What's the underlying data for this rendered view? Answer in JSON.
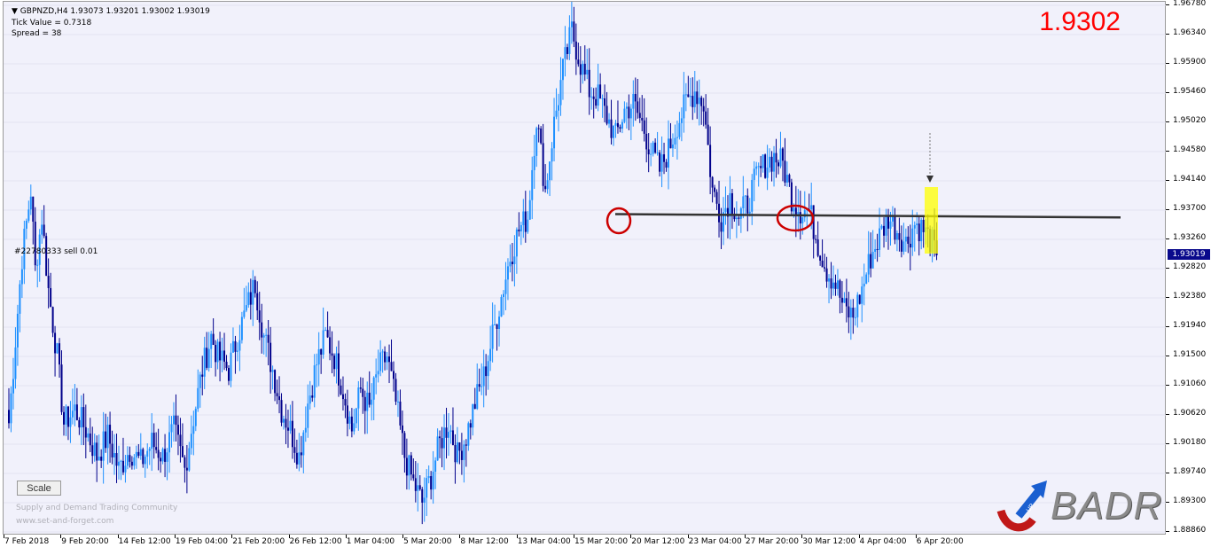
{
  "header": {
    "title_arrow": "▼",
    "symbol_line": "GBPNZD,H4  1.93073 1.93201 1.93002 1.93019",
    "tick_value": "Tick Value = 0.7318",
    "spread": "Spread = 38"
  },
  "big_price": "1.9302",
  "order_label": "#22780333 sell 0.01",
  "scale_button": "Scale",
  "watermark": {
    "line1": "Supply and Demand Trading Community",
    "line2": "www.set-and-forget.com"
  },
  "logo": {
    "text": "BADR",
    "small_text": "UP"
  },
  "price_axis": {
    "labels": [
      "1.96780",
      "1.96340",
      "1.95900",
      "1.95460",
      "1.95020",
      "1.94580",
      "1.94140",
      "1.93700",
      "1.93260",
      "1.92820",
      "1.92380",
      "1.91940",
      "1.91500",
      "1.91060",
      "1.90620",
      "1.90180",
      "1.89740",
      "1.89300",
      "1.88860"
    ],
    "current_price": "1.93019"
  },
  "time_axis": {
    "labels": [
      "7 Feb 2018",
      "9 Feb 20:00",
      "14 Feb 12:00",
      "19 Feb 04:00",
      "21 Feb 20:00",
      "26 Feb 12:00",
      "1 Mar 04:00",
      "5 Mar 20:00",
      "8 Mar 12:00",
      "13 Mar 04:00",
      "15 Mar 20:00",
      "20 Mar 12:00",
      "23 Mar 04:00",
      "27 Mar 20:00",
      "30 Mar 12:00",
      "4 Apr 04:00",
      "6 Apr 20:00"
    ]
  },
  "colors": {
    "bull": "#1e90ff",
    "bear": "#00008b",
    "background": "#f1f1fb",
    "price_highlight": "#ff0000",
    "level_line": "#333333",
    "highlight_box": "#ffff00",
    "circle": "#cc0000"
  },
  "chart_data": {
    "type": "candlestick",
    "symbol": "GBPNZD",
    "timeframe": "H4",
    "ylim": [
      1.8886,
      1.9678
    ],
    "ohlc_last": {
      "open": 1.93073,
      "high": 1.93201,
      "low": 1.93002,
      "close": 1.93019
    },
    "close_path": [
      [
        0,
        1.905
      ],
      [
        6,
        1.93
      ],
      [
        10,
        1.94
      ],
      [
        12,
        1.928
      ],
      [
        15,
        1.936
      ],
      [
        18,
        1.925
      ],
      [
        22,
        1.915
      ],
      [
        25,
        1.905
      ],
      [
        30,
        1.907
      ],
      [
        35,
        1.904
      ],
      [
        40,
        1.9
      ],
      [
        45,
        1.903
      ],
      [
        50,
        1.898
      ],
      [
        55,
        1.901
      ],
      [
        60,
        1.899
      ],
      [
        65,
        1.902
      ],
      [
        70,
        1.9
      ],
      [
        75,
        1.904
      ],
      [
        80,
        1.898
      ],
      [
        83,
        1.904
      ],
      [
        88,
        1.913
      ],
      [
        92,
        1.918
      ],
      [
        95,
        1.915
      ],
      [
        100,
        1.913
      ],
      [
        104,
        1.918
      ],
      [
        108,
        1.922
      ],
      [
        112,
        1.926
      ],
      [
        116,
        1.918
      ],
      [
        120,
        1.913
      ],
      [
        124,
        1.907
      ],
      [
        128,
        1.904
      ],
      [
        132,
        1.9
      ],
      [
        136,
        1.908
      ],
      [
        140,
        1.914
      ],
      [
        144,
        1.918
      ],
      [
        148,
        1.915
      ],
      [
        152,
        1.91
      ],
      [
        156,
        1.904
      ],
      [
        160,
        1.91
      ],
      [
        164,
        1.907
      ],
      [
        168,
        1.913
      ],
      [
        172,
        1.915
      ],
      [
        176,
        1.908
      ],
      [
        180,
        1.9
      ],
      [
        184,
        1.896
      ],
      [
        188,
        1.893
      ],
      [
        192,
        1.897
      ],
      [
        196,
        1.902
      ],
      [
        200,
        1.905
      ],
      [
        204,
        1.9
      ],
      [
        208,
        1.903
      ],
      [
        212,
        1.908
      ],
      [
        216,
        1.912
      ],
      [
        220,
        1.918
      ],
      [
        224,
        1.924
      ],
      [
        228,
        1.93
      ],
      [
        232,
        1.934
      ],
      [
        236,
        1.936
      ],
      [
        240,
        1.951
      ],
      [
        244,
        1.94
      ],
      [
        248,
        1.95
      ],
      [
        252,
        1.958
      ],
      [
        256,
        1.964
      ],
      [
        260,
        1.959
      ],
      [
        264,
        1.955
      ],
      [
        268,
        1.954
      ],
      [
        272,
        1.951
      ],
      [
        276,
        1.948
      ],
      [
        280,
        1.952
      ],
      [
        284,
        1.953
      ],
      [
        288,
        1.95
      ],
      [
        292,
        1.946
      ],
      [
        296,
        1.943
      ],
      [
        300,
        1.946
      ],
      [
        304,
        1.95
      ],
      [
        308,
        1.953
      ],
      [
        312,
        1.955
      ],
      [
        316,
        1.953
      ],
      [
        320,
        1.94
      ],
      [
        324,
        1.936
      ],
      [
        328,
        1.939
      ],
      [
        332,
        1.936
      ],
      [
        336,
        1.938
      ],
      [
        340,
        1.942
      ],
      [
        344,
        1.944
      ],
      [
        348,
        1.945
      ],
      [
        352,
        1.944
      ],
      [
        356,
        1.939
      ],
      [
        360,
        1.937
      ],
      [
        364,
        1.937
      ],
      [
        368,
        1.932
      ],
      [
        372,
        1.928
      ],
      [
        376,
        1.926
      ],
      [
        380,
        1.922
      ],
      [
        384,
        1.921
      ],
      [
        388,
        1.925
      ],
      [
        392,
        1.93
      ],
      [
        396,
        1.933
      ],
      [
        400,
        1.936
      ],
      [
        404,
        1.934
      ],
      [
        408,
        1.932
      ],
      [
        412,
        1.935
      ],
      [
        416,
        1.934
      ],
      [
        420,
        1.932
      ],
      [
        422,
        1.9302
      ]
    ],
    "horizontal_level": {
      "price_start": 1.9364,
      "price_end": 1.9359
    },
    "annotations": [
      "red circle at first touch of level",
      "red circle at second touch of level",
      "yellow highlight box on latest candles",
      "dotted down arrow above highlight"
    ]
  }
}
